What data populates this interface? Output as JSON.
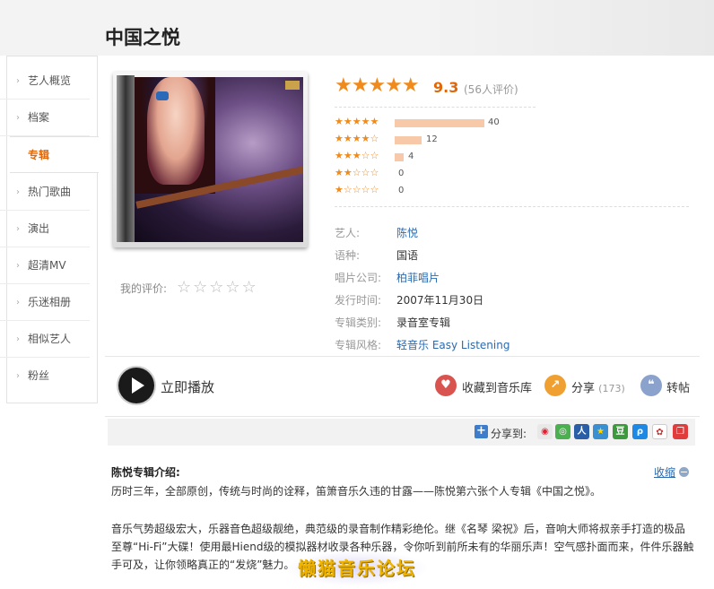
{
  "page": {
    "title": "中国之悦"
  },
  "sidebar": {
    "items": [
      {
        "label": "艺人概览"
      },
      {
        "label": "档案"
      },
      {
        "label": "专辑"
      },
      {
        "label": "热门歌曲"
      },
      {
        "label": "演出"
      },
      {
        "label": "超清MV"
      },
      {
        "label": "乐迷相册"
      },
      {
        "label": "相似艺人"
      },
      {
        "label": "粉丝"
      }
    ],
    "active_index": 2
  },
  "rating": {
    "score": "9.3",
    "count_text": "(56人评价)",
    "distribution": [
      {
        "stars": "★★★★★",
        "count": 40
      },
      {
        "stars": "★★★★☆",
        "count": 12
      },
      {
        "stars": "★★★☆☆",
        "count": 4
      },
      {
        "stars": "★★☆☆☆",
        "count": 0
      },
      {
        "stars": "★☆☆☆☆",
        "count": 0
      }
    ],
    "my_rating_label": "我的评价:",
    "my_rating_stars": "☆☆☆☆☆"
  },
  "info": [
    {
      "key": "艺人:",
      "value": "陈悦",
      "link": true
    },
    {
      "key": "语种:",
      "value": "国语",
      "link": false
    },
    {
      "key": "唱片公司:",
      "value": "柏菲唱片",
      "link": true
    },
    {
      "key": "发行时间:",
      "value": "2007年11月30日",
      "link": false
    },
    {
      "key": "专辑类别:",
      "value": "录音室专辑",
      "link": false
    },
    {
      "key": "专辑风格:",
      "value": "轻音乐 Easy Listening",
      "link": true
    }
  ],
  "actions": {
    "play_label": "立即播放",
    "collect_label": "收藏到音乐库",
    "share_label": "分享",
    "share_count": "(173)",
    "repost_label": "转帖"
  },
  "share_to": {
    "label": "分享到:"
  },
  "description": {
    "title": "陈悦专辑介绍:",
    "collapse_label": "收缩",
    "paragraphs": [
      "历时三年，全部原创，传统与时尚的诠释，笛箫音乐久违的甘露——陈悦第六张个人专辑《中国之悦》。",
      "音乐气势超级宏大，乐器音色超级靓绝，典范级的录音制作精彩绝伦。继《名琴 梁祝》后，音响大师将叔亲手打造的极品至尊“Hi-Fi”大碟！使用最Hiend级的模拟器材收录各种乐器，令你听到前所未有的华丽乐声！空气感扑面而来，件件乐器触手可及，让你领略真正的“发烧”魅力。"
    ]
  },
  "watermark": {
    "text": "懒猫音乐论坛"
  },
  "colors": {
    "accent": "#e0680a",
    "link": "#2b6ab0",
    "star": "#f08a1d"
  }
}
